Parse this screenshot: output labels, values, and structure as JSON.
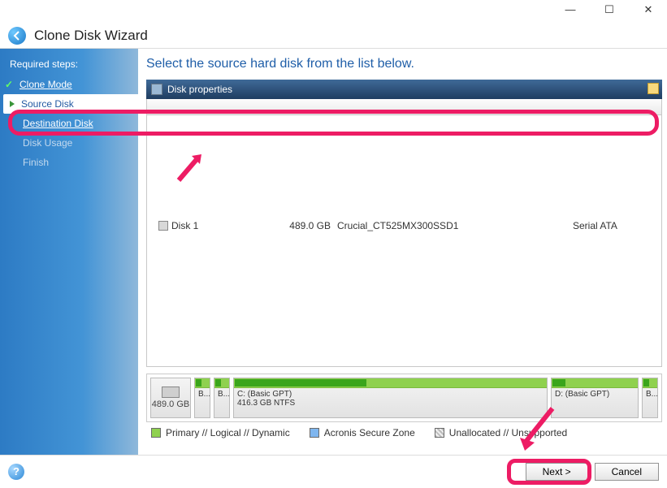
{
  "window": {
    "minimize": "—",
    "maximize": "☐",
    "close": "✕"
  },
  "header": {
    "title": "Clone Disk Wizard"
  },
  "sidebar": {
    "heading": "Required steps:",
    "steps": [
      {
        "label": "Clone Mode"
      },
      {
        "label": "Source Disk"
      },
      {
        "label": "Destination Disk"
      },
      {
        "label": "Disk Usage"
      },
      {
        "label": "Finish"
      }
    ]
  },
  "main": {
    "title": "Select the source hard disk from the list below.",
    "disk_properties_label": "Disk properties",
    "disks": [
      {
        "name": "Disk 1",
        "capacity": "489.0 GB",
        "model": "Crucial_CT525MX300SSD1",
        "interface": "Serial ATA"
      }
    ],
    "map": {
      "size_label": "489.0 GB",
      "partitions": [
        {
          "label": "B..."
        },
        {
          "label": "B..."
        },
        {
          "title": "C: (Basic GPT)",
          "detail": "416.3 GB  NTFS"
        },
        {
          "title": "D: (Basic GPT)"
        },
        {
          "label": "B..."
        }
      ]
    },
    "legend": {
      "primary": "Primary // Logical // Dynamic",
      "acronis": "Acronis Secure Zone",
      "unallocated": "Unallocated // Unsupported"
    }
  },
  "footer": {
    "next_label": "Next >",
    "cancel_label": "Cancel"
  }
}
